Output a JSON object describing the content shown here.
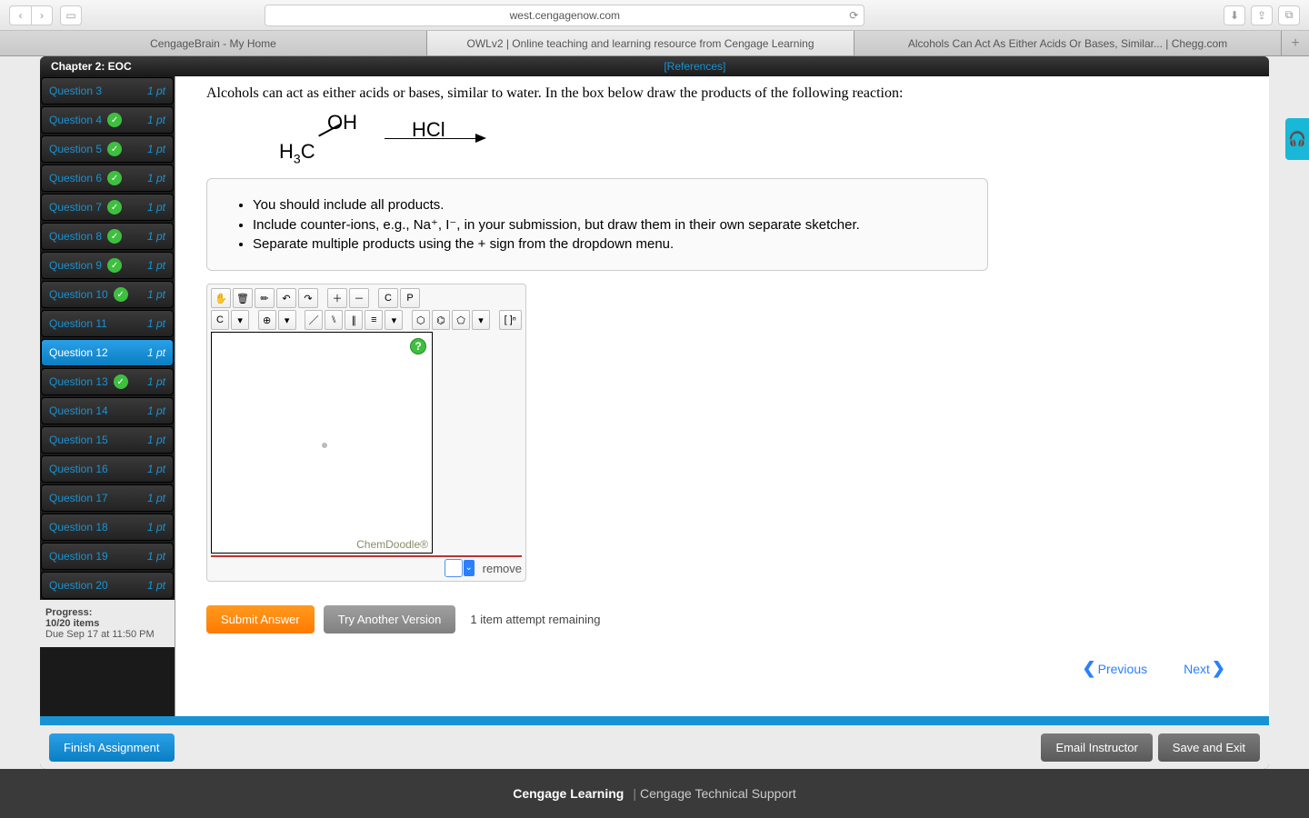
{
  "browser": {
    "url": "west.cengagenow.com",
    "tabs": [
      {
        "label": "CengageBrain - My Home",
        "active": false
      },
      {
        "label": "OWLv2 | Online teaching and learning resource from Cengage Learning",
        "active": true
      },
      {
        "label": "Alcohols Can Act As Either Acids Or Bases, Similar... | Chegg.com",
        "active": false
      }
    ]
  },
  "header": {
    "chapter": "Chapter 2: EOC",
    "references": "[References]"
  },
  "questions": [
    {
      "label": "Question 3",
      "pts": "1 pt",
      "checked": false
    },
    {
      "label": "Question 4",
      "pts": "1 pt",
      "checked": true
    },
    {
      "label": "Question 5",
      "pts": "1 pt",
      "checked": true
    },
    {
      "label": "Question 6",
      "pts": "1 pt",
      "checked": true
    },
    {
      "label": "Question 7",
      "pts": "1 pt",
      "checked": true
    },
    {
      "label": "Question 8",
      "pts": "1 pt",
      "checked": true
    },
    {
      "label": "Question 9",
      "pts": "1 pt",
      "checked": true
    },
    {
      "label": "Question 10",
      "pts": "1 pt",
      "checked": true
    },
    {
      "label": "Question 11",
      "pts": "1 pt",
      "checked": false
    },
    {
      "label": "Question 12",
      "pts": "1 pt",
      "checked": false,
      "active": true
    },
    {
      "label": "Question 13",
      "pts": "1 pt",
      "checked": true
    },
    {
      "label": "Question 14",
      "pts": "1 pt",
      "checked": false
    },
    {
      "label": "Question 15",
      "pts": "1 pt",
      "checked": false
    },
    {
      "label": "Question 16",
      "pts": "1 pt",
      "checked": false
    },
    {
      "label": "Question 17",
      "pts": "1 pt",
      "checked": false
    },
    {
      "label": "Question 18",
      "pts": "1 pt",
      "checked": false
    },
    {
      "label": "Question 19",
      "pts": "1 pt",
      "checked": false
    },
    {
      "label": "Question 20",
      "pts": "1 pt",
      "checked": false
    }
  ],
  "progress": {
    "heading": "Progress:",
    "items": "10/20 items",
    "due": "Due Sep 17 at 11:50 PM"
  },
  "content": {
    "prompt": "Alcohols can act as either acids or bases, similar to water. In the box below draw the products of the following reaction:",
    "reactant": {
      "oh": "OH",
      "h3c_pre": "H",
      "h3c_sub": "3",
      "h3c_post": "C"
    },
    "reagent": "HCl",
    "hints": [
      "You should include all products.",
      "Include counter-ions, e.g., Na⁺, I⁻, in your submission, but draw them in their own separate sketcher.",
      "Separate multiple products using the + sign from the dropdown menu."
    ],
    "sketch": {
      "brand": "ChemDoodle®",
      "remove": "remove"
    },
    "actions": {
      "submit": "Submit Answer",
      "try": "Try Another Version",
      "attempts": "1 item attempt remaining"
    },
    "nav": {
      "prev": "Previous",
      "next": "Next"
    }
  },
  "bottom": {
    "finish": "Finish Assignment",
    "email": "Email Instructor",
    "save": "Save and Exit"
  },
  "footer": {
    "brand": "Cengage Learning",
    "sep": "|",
    "support": "Cengage Technical Support"
  }
}
